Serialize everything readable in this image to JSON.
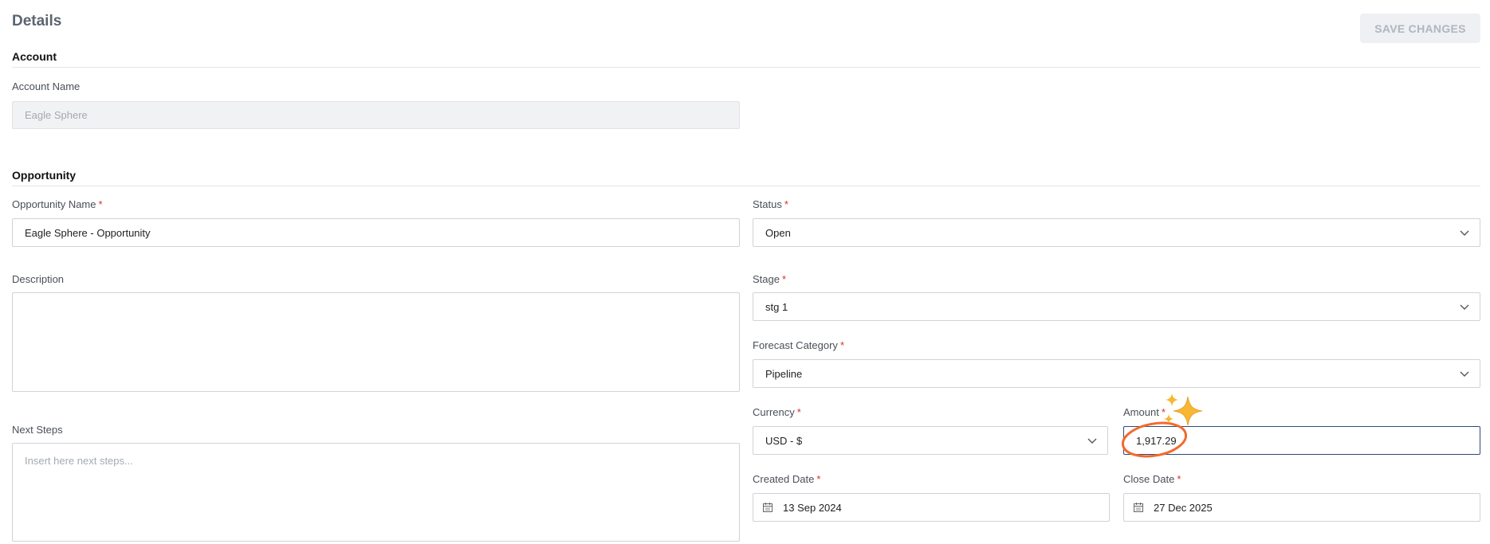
{
  "header": {
    "title": "Details",
    "save_label": "SAVE CHANGES"
  },
  "account": {
    "section_title": "Account",
    "name_label": "Account Name",
    "name_value": "Eagle Sphere"
  },
  "opportunity": {
    "section_title": "Opportunity",
    "name_label": "Opportunity Name",
    "name_value": "Eagle Sphere - Opportunity",
    "status_label": "Status",
    "status_value": "Open",
    "description_label": "Description",
    "description_value": "",
    "stage_label": "Stage",
    "stage_value": "stg 1",
    "forecast_label": "Forecast Category",
    "forecast_value": "Pipeline",
    "next_steps_label": "Next Steps",
    "next_steps_placeholder": "Insert here next steps...",
    "currency_label": "Currency",
    "currency_value": "USD - $",
    "amount_label": "Amount",
    "amount_value": "1,917.29",
    "created_label": "Created Date",
    "created_value": "13 Sep 2024",
    "close_label": "Close Date",
    "close_value": "27 Dec 2025"
  },
  "required_marker": "*",
  "icons": {
    "chevron": "chevron-down-icon",
    "calendar": "calendar-icon",
    "sparkle": "sparkle-icon"
  },
  "colors": {
    "accent_focus": "#2f4a7a",
    "required": "#d93025",
    "annotation": "#f26a2e",
    "sparkle": "#f7b733"
  }
}
